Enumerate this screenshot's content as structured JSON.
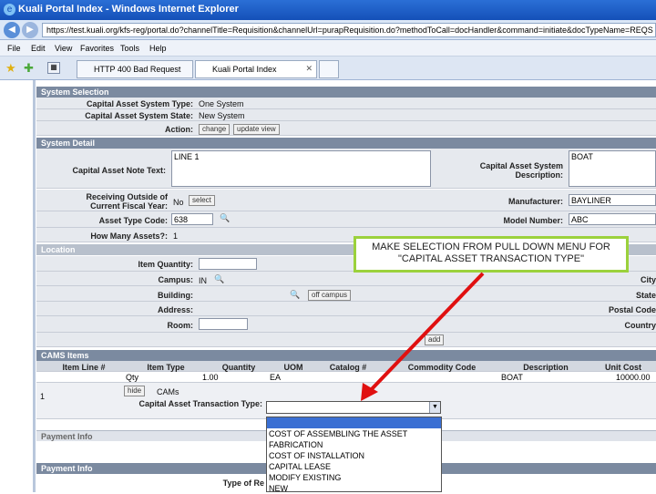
{
  "browser": {
    "title": "Kuali Portal Index - Windows Internet Explorer",
    "url": "https://test.kuali.org/kfs-reg/portal.do?channelTitle=Requisition&channelUrl=purapRequisition.do?methodToCall=docHandler&command=initiate&docTypeName=REQS",
    "menu": [
      "File",
      "Edit",
      "View",
      "Favorites",
      "Tools",
      "Help"
    ],
    "tabs": [
      "HTTP 400 Bad Request",
      "Kuali Portal Index"
    ]
  },
  "system_selection": {
    "header": "System Selection",
    "type_label": "Capital Asset System Type:",
    "type_value": "One System",
    "state_label": "Capital Asset System State:",
    "state_value": "New System",
    "action_label": "Action:",
    "change_btn": "change",
    "update_btn": "update view"
  },
  "system_detail": {
    "header": "System Detail",
    "note_label": "Capital Asset Note Text:",
    "note_value": "LINE 1",
    "desc_label": "Capital Asset System Description:",
    "desc_value": "BOAT",
    "fiscal_label": "Receiving Outside of Current Fiscal Year:",
    "fiscal_value": "No",
    "select_btn": "select",
    "manufacturer_label": "Manufacturer:",
    "manufacturer_value": "BAYLINER",
    "asset_type_label": "Asset Type Code:",
    "asset_type_value": "638",
    "model_label": "Model Number:",
    "model_value": "ABC",
    "how_many_label": "How Many Assets?:",
    "how_many_value": "1"
  },
  "location": {
    "header": "Location",
    "qty_label": "Item Quantity:",
    "campus_label": "Campus:",
    "campus_value": "IN",
    "building_label": "Building:",
    "offcampus_btn": "off campus",
    "address_label": "Address:",
    "room_label": "Room:",
    "city_label": "City",
    "state_label": "State",
    "postal_label": "Postal Code",
    "country_label": "Country",
    "add_btn": "add"
  },
  "cams": {
    "header": "CAMS Items",
    "columns": [
      "Item Line #",
      "Item Type",
      "Quantity",
      "UOM",
      "Catalog #",
      "Commodity Code",
      "Description",
      "Unit Cost"
    ],
    "row": {
      "item_type": "Qty",
      "quantity": "1.00",
      "uom": "EA",
      "description": "BOAT",
      "unit_cost": "10000.00",
      "line": "1"
    },
    "hide_btn": "hide",
    "cams_label": "CAMs",
    "transaction_label": "Capital Asset Transaction Type:",
    "transaction_value": ""
  },
  "dropdown_options": [
    "",
    "COST OF ASSEMBLING THE ASSET",
    "FABRICATION",
    "COST OF INSTALLATION",
    "CAPITAL LEASE",
    "MODIFY EXISTING",
    "NEW"
  ],
  "payment": {
    "header1": "Payment Info",
    "header2": "Payment Info",
    "type_label": "Type of Re"
  },
  "callout": {
    "text": "MAKE SELECTION FROM PULL DOWN MENU FOR \"CAPITAL ASSET TRANSACTION TYPE\""
  },
  "colors": {
    "callout_border": "#9bd13c",
    "arrow": "#e01010",
    "header": "#7b8aa0"
  }
}
